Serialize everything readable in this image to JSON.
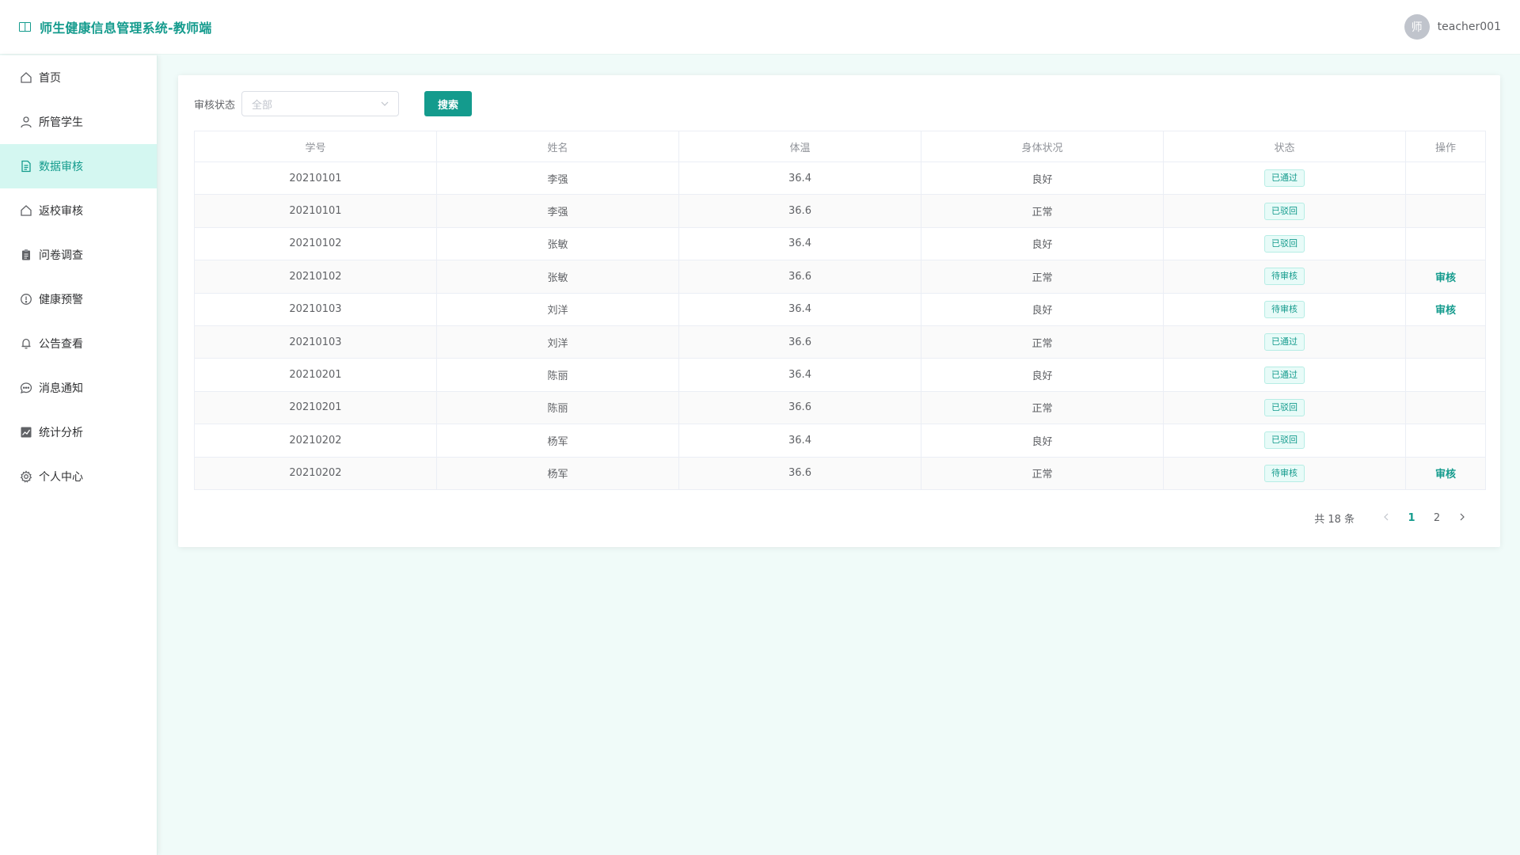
{
  "header": {
    "title": "师生健康信息管理系统-教师端",
    "avatar_text": "师",
    "username": "teacher001"
  },
  "sidebar": {
    "items": [
      {
        "label": "首页",
        "icon": "home-icon"
      },
      {
        "label": "所管学生",
        "icon": "user-icon"
      },
      {
        "label": "数据审核",
        "icon": "document-icon",
        "active": true
      },
      {
        "label": "返校审核",
        "icon": "house-icon"
      },
      {
        "label": "问卷调查",
        "icon": "clipboard-icon"
      },
      {
        "label": "健康预警",
        "icon": "warning-icon"
      },
      {
        "label": "公告查看",
        "icon": "bell-icon"
      },
      {
        "label": "消息通知",
        "icon": "chat-icon"
      },
      {
        "label": "统计分析",
        "icon": "chart-icon"
      },
      {
        "label": "个人中心",
        "icon": "gear-icon"
      }
    ]
  },
  "filter": {
    "label": "审核状态",
    "select_value": "全部",
    "search_label": "搜索"
  },
  "table": {
    "headers": [
      "学号",
      "姓名",
      "体温",
      "身体状况",
      "状态",
      "操作"
    ],
    "rows": [
      {
        "id": "20210101",
        "name": "李强",
        "temp": "36.4",
        "condition": "良好",
        "status": "已通过",
        "action": ""
      },
      {
        "id": "20210101",
        "name": "李强",
        "temp": "36.6",
        "condition": "正常",
        "status": "已驳回",
        "action": ""
      },
      {
        "id": "20210102",
        "name": "张敏",
        "temp": "36.4",
        "condition": "良好",
        "status": "已驳回",
        "action": ""
      },
      {
        "id": "20210102",
        "name": "张敏",
        "temp": "36.6",
        "condition": "正常",
        "status": "待审核",
        "action": "审核"
      },
      {
        "id": "20210103",
        "name": "刘洋",
        "temp": "36.4",
        "condition": "良好",
        "status": "待审核",
        "action": "审核"
      },
      {
        "id": "20210103",
        "name": "刘洋",
        "temp": "36.6",
        "condition": "正常",
        "status": "已通过",
        "action": ""
      },
      {
        "id": "20210201",
        "name": "陈丽",
        "temp": "36.4",
        "condition": "良好",
        "status": "已通过",
        "action": ""
      },
      {
        "id": "20210201",
        "name": "陈丽",
        "temp": "36.6",
        "condition": "正常",
        "status": "已驳回",
        "action": ""
      },
      {
        "id": "20210202",
        "name": "杨军",
        "temp": "36.4",
        "condition": "良好",
        "status": "已驳回",
        "action": ""
      },
      {
        "id": "20210202",
        "name": "杨军",
        "temp": "36.6",
        "condition": "正常",
        "status": "待审核",
        "action": "审核"
      }
    ]
  },
  "pagination": {
    "total_text": "共 18 条",
    "pages": [
      "1",
      "2"
    ],
    "current": "1"
  },
  "colors": {
    "accent": "#149b8d",
    "active_bg": "#d4f7f1",
    "page_bg": "#f0fbf9"
  }
}
